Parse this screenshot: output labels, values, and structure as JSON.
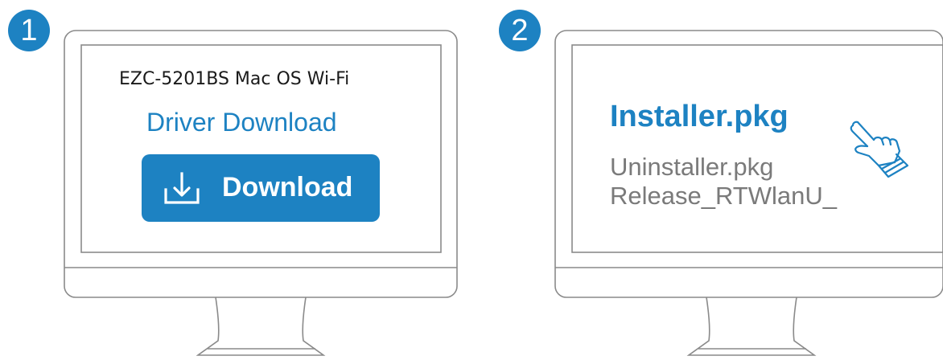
{
  "steps": [
    {
      "number": "1",
      "model_title": "EZC-5201BS Mac OS Wi-Fi",
      "heading": "Driver Download",
      "button_label": "Download",
      "button_icon": "download-icon"
    },
    {
      "number": "2",
      "files": [
        "Installer.pkg",
        "Uninstaller.pkg",
        "Release_RTWlanU_"
      ],
      "pointer_icon": "hand-pointer-icon"
    }
  ],
  "colors": {
    "accent": "#1d82c2",
    "monitor_outline": "#8a8a8a",
    "muted_text": "#7a7a7a",
    "dark_text": "#1a1a1a"
  }
}
